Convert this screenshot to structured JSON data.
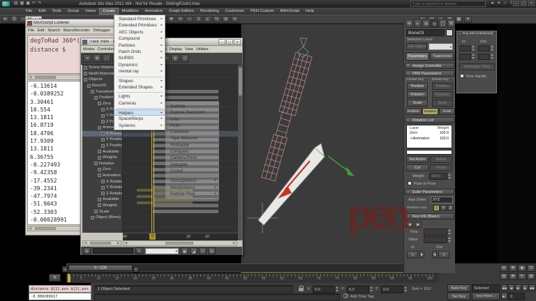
{
  "titlebar": {
    "title": "Autodesk 3ds Max 2012 x64 - Not for Resale - StirlingRJoint.max",
    "search_placeholder": "Type a keyword or phrase",
    "quick_icons": [
      {
        "name": "new-scene-icon",
        "glyph": "▤"
      },
      {
        "name": "open-file-icon",
        "glyph": "▦"
      },
      {
        "name": "save-file-icon",
        "glyph": "▣"
      },
      {
        "name": "undo-icon",
        "glyph": "↶"
      },
      {
        "name": "redo-icon",
        "glyph": "↷"
      }
    ],
    "right_icons": [
      {
        "name": "search-go-icon",
        "glyph": "➤"
      },
      {
        "name": "communication-center-icon",
        "glyph": "✦"
      },
      {
        "name": "favorites-icon",
        "glyph": "☆"
      },
      {
        "name": "help-icon",
        "glyph": "?"
      }
    ],
    "window_buttons": [
      {
        "name": "minimize-button",
        "glyph": "—"
      },
      {
        "name": "maximize-button",
        "glyph": "▢"
      },
      {
        "name": "close-button",
        "glyph": "✕"
      }
    ]
  },
  "menubar": {
    "items": [
      {
        "label": "File"
      },
      {
        "label": "Edit"
      },
      {
        "label": "Tools"
      },
      {
        "label": "Group"
      },
      {
        "label": "Views"
      },
      {
        "label": "Create",
        "cls": "active"
      },
      {
        "label": "Modifiers"
      },
      {
        "label": "Animation"
      },
      {
        "label": "Graph Editors"
      },
      {
        "label": "Rendering"
      },
      {
        "label": "Customize"
      },
      {
        "label": "PEN Custom"
      },
      {
        "label": "MAXScript"
      },
      {
        "label": "Help"
      }
    ]
  },
  "toolbar": {
    "filter_value": "All",
    "left_icons": [
      {
        "name": "select-object-icon",
        "glyph": "➤"
      },
      {
        "name": "select-by-name-icon",
        "glyph": "☰"
      },
      {
        "name": "rectangular-region-icon",
        "glyph": "▭"
      }
    ],
    "mid_icons": [
      {
        "name": "select-move-icon",
        "glyph": "✥"
      },
      {
        "name": "select-rotate-icon",
        "glyph": "↻"
      },
      {
        "name": "select-scale-icon",
        "glyph": "▱"
      },
      {
        "name": "snap-toggle-icon",
        "glyph": "3"
      },
      {
        "name": "angle-snap-icon",
        "glyph": "∠"
      },
      {
        "name": "percent-snap-icon",
        "glyph": "%"
      },
      {
        "name": "mirror-icon",
        "glyph": "⊞"
      },
      {
        "name": "align-icon",
        "glyph": "≋"
      }
    ],
    "right_icons": [
      {
        "name": "curve-editor-icon",
        "glyph": "∿"
      },
      {
        "name": "schematic-view-icon",
        "glyph": "⊡"
      },
      {
        "name": "material-editor-icon",
        "glyph": "◑"
      },
      {
        "name": "render-setup-icon",
        "glyph": "⚙"
      },
      {
        "name": "render-frame-icon",
        "glyph": "▦"
      },
      {
        "name": "render-icon",
        "glyph": "✦"
      }
    ]
  },
  "create_menu": {
    "items": [
      {
        "label": "Standard Primitives"
      },
      {
        "label": "Extended Primitives"
      },
      {
        "label": "AEC Objects"
      },
      {
        "label": "Compound"
      },
      {
        "label": "Particles"
      },
      {
        "label": "Patch Grids"
      },
      {
        "label": "NURBS"
      },
      {
        "label": "Dynamics"
      },
      {
        "label": "mental ray"
      },
      {
        "label": "",
        "cls": "sep"
      },
      {
        "label": "Shapes"
      },
      {
        "label": "Extended Shapes"
      },
      {
        "label": "",
        "cls": "sep"
      },
      {
        "label": "Lights"
      },
      {
        "label": "Cameras"
      },
      {
        "label": "",
        "cls": "sep"
      },
      {
        "label": "Helpers",
        "cls": "hl"
      },
      {
        "label": "SpaceWarps"
      },
      {
        "label": "Systems"
      }
    ]
  },
  "helpers_submenu": {
    "items": [
      {
        "label": "Dummy"
      },
      {
        "label": "Expose Transform"
      },
      {
        "label": "Grid"
      },
      {
        "label": "Point"
      },
      {
        "label": "Container"
      },
      {
        "label": "Tape Measure"
      },
      {
        "label": "Protractor"
      },
      {
        "label": "Compass"
      },
      {
        "label": "Camera Point"
      },
      {
        "label": "Delegate"
      },
      {
        "label": "Crowd"
      },
      {
        "label": "",
        "cls": "sep"
      },
      {
        "label": "Atmospherics",
        "cls": "arrow"
      },
      {
        "label": "Manipulators",
        "cls": "arrow"
      },
      {
        "label": "Particle Flow",
        "cls": "arrow"
      }
    ]
  },
  "listener": {
    "title": "MAXScript Listener",
    "menus": [
      {
        "label": "File"
      },
      {
        "label": "Edit"
      },
      {
        "label": "Search"
      },
      {
        "label": "MacroRecorder"
      },
      {
        "label": "Debugger"
      }
    ],
    "pink_lines": "degToRad 360*(9\ndistance $",
    "values": [
      "-6.13614",
      "-0.0389252",
      "3.30461",
      "10.554",
      "13.1811",
      "16.8719",
      "18.4706",
      "17.9309",
      "13.1811",
      "6.36755",
      "-0.227493",
      "-9.42358",
      "-17.4552",
      "-39.2341",
      "-47.7974",
      "-51.9043",
      "-52.3303",
      "-0.00028991"
    ]
  },
  "track_view": {
    "title": "Track View - Dope Sheet",
    "menus": [
      {
        "label": "Modes"
      },
      {
        "label": "Controller"
      },
      {
        "label": "Tracks"
      },
      {
        "label": "Keys"
      },
      {
        "label": "Time"
      },
      {
        "label": "Options"
      },
      {
        "label": "Display"
      },
      {
        "label": "View"
      },
      {
        "label": "Utilities"
      }
    ],
    "toolbar_icons": [
      {
        "name": "filters-icon",
        "glyph": "≡"
      },
      {
        "name": "move-keys-icon",
        "glyph": "✥"
      },
      {
        "name": "slide-keys-icon",
        "glyph": "↔"
      },
      {
        "name": "scale-keys-icon",
        "glyph": "▱"
      },
      {
        "name": "add-keys-icon",
        "glyph": "◆"
      },
      {
        "name": "draw-curves-icon",
        "glyph": "✎"
      },
      {
        "name": "edit-ranges-icon",
        "glyph": "⊞"
      },
      {
        "name": "snap-frames-icon",
        "glyph": "◇"
      },
      {
        "name": "cut-keys-icon",
        "glyph": "✂"
      },
      {
        "name": "zoom-icon",
        "glyph": "⊕"
      },
      {
        "name": "pan-icon",
        "glyph": "⊙"
      }
    ],
    "tree": [
      {
        "label": "Scene Materials",
        "cls": "l0"
      },
      {
        "label": "Medit Materials",
        "cls": "l0"
      },
      {
        "label": "Objects",
        "cls": "l0"
      },
      {
        "label": "Bone03",
        "cls": "l1"
      },
      {
        "label": "Transform",
        "cls": "l2"
      },
      {
        "label": "Position",
        "cls": "l3"
      },
      {
        "label": "Zero",
        "cls": "l4"
      },
      {
        "label": "X Position",
        "cls": "l5"
      },
      {
        "label": "Y Position",
        "cls": "l5"
      },
      {
        "label": "Z Position",
        "cls": "l5"
      },
      {
        "label": "Animation",
        "cls": "l4"
      },
      {
        "label": "X Position",
        "cls": "l5 sel"
      },
      {
        "label": "Y Position",
        "cls": "l5"
      },
      {
        "label": "Z Position",
        "cls": "l5"
      },
      {
        "label": "Available",
        "cls": "l4"
      },
      {
        "label": "Weights",
        "cls": "l4"
      },
      {
        "label": "Rotation",
        "cls": "l3"
      },
      {
        "label": "Zero",
        "cls": "l4"
      },
      {
        "label": "Animation",
        "cls": "l4"
      },
      {
        "label": "X Rotation",
        "cls": "l5"
      },
      {
        "label": "Y Rotation",
        "cls": "l5"
      },
      {
        "label": "Z Rotation",
        "cls": "l5"
      },
      {
        "label": "Available",
        "cls": "l4"
      },
      {
        "label": "Weights",
        "cls": "l4"
      },
      {
        "label": "Scale",
        "cls": "l3"
      },
      {
        "label": "Object (Bone)",
        "cls": "l2"
      }
    ],
    "ruler_labels": [
      {
        "label": ""
      },
      {
        "label": "30"
      },
      {
        "label": "60"
      },
      {
        "label": "90"
      }
    ],
    "ruler_marker": "0",
    "footer_icons": [
      {
        "name": "track-select-icon",
        "glyph": "▣"
      },
      {
        "name": "key-stats-icon",
        "glyph": "◪"
      },
      {
        "name": "time-tools-icon",
        "glyph": "⊟"
      },
      {
        "name": "maximize-icon",
        "glyph": "⊞"
      }
    ]
  },
  "command_panel": {
    "tabs": [
      {
        "name": "tab-create",
        "glyph": "✛"
      },
      {
        "name": "tab-modify",
        "glyph": "◐"
      },
      {
        "name": "tab-hierarchy",
        "glyph": "≣"
      },
      {
        "name": "tab-motion",
        "glyph": "◎",
        "cls": "on"
      },
      {
        "name": "tab-display",
        "glyph": "▢"
      },
      {
        "name": "tab-utilities",
        "glyph": "⚒"
      }
    ],
    "object_name": "Bone03",
    "selection_level_label": "Selection Level:",
    "subobject_button": "Sub-Object",
    "parameters_button": "Parameters",
    "trajectories_button": "Trajectories",
    "assign_controller_title": "Assign Controller",
    "prs": {
      "title": "PRS Parameters",
      "create_key_label": "Create Key:",
      "delete_key_label": "Delete Key:",
      "create_keys": [
        {
          "label": "Position"
        },
        {
          "label": "Rotation"
        },
        {
          "label": "Scale"
        }
      ],
      "delete_keys": [
        {
          "label": "Position"
        },
        {
          "label": "Rotation"
        },
        {
          "label": "Scale"
        }
      ],
      "mode_buttons": [
        {
          "label": "Position"
        },
        {
          "label": "Rotation",
          "cls": "tan"
        },
        {
          "label": "Scale"
        }
      ]
    },
    "rotation_list": {
      "title": "Rotation List",
      "col_layer": "Layer",
      "col_weight": "Weight",
      "rows": [
        {
          "layer": "Zero",
          "weight": "100.0"
        },
        {
          "layer": "->Animation",
          "weight": "100.0"
        }
      ],
      "set_active_button": "Set Active",
      "delete_button": "Delete",
      "cut_button": "Cut",
      "paste_button": "Paste",
      "weight_label": "Weight:",
      "weight_value": "100.0",
      "pose_to_pose_label": "Pose to Pose"
    },
    "euler": {
      "title": "Euler Parameters",
      "axis_order_label": "Axis Order:",
      "axis_order_value": "XYZ",
      "rotation_axis_label": "Rotation Axis:",
      "axes": [
        {
          "label": "X",
          "cls": "tan"
        },
        {
          "label": "Y"
        },
        {
          "label": "Z"
        }
      ]
    },
    "key_info_basic": {
      "title": "Key Info (Basic)",
      "time_label": "Time:",
      "value_label": "Value:",
      "in_label": "In:",
      "out_label": "Out:"
    }
  },
  "key_info_advanced": {
    "title": "Key Info (Advanced)",
    "in_label": "In:",
    "out_label": "Out:",
    "normalize_button": "Normalize Time",
    "free_handle_label": "Free Handle"
  },
  "timeline": {
    "range": "0 / 100",
    "tick_labels": [
      {
        "label": "5"
      },
      {
        "label": "10"
      },
      {
        "label": "15"
      },
      {
        "label": "20"
      },
      {
        "label": "25"
      },
      {
        "label": "30"
      },
      {
        "label": "35"
      },
      {
        "label": "40"
      },
      {
        "label": "45"
      },
      {
        "label": "50"
      },
      {
        "label": "55"
      },
      {
        "label": "60"
      },
      {
        "label": "65"
      },
      {
        "label": "70"
      },
      {
        "label": "75"
      },
      {
        "label": "80"
      },
      {
        "label": "85"
      },
      {
        "label": "90"
      },
      {
        "label": "95"
      },
      {
        "label": "100"
      }
    ]
  },
  "status": {
    "mini_listener": "distance $[1].pos $[2].pos",
    "mini_result": "-0.000289917",
    "selection_status": "1 Object Selected",
    "prompt": "",
    "x_label": "X:",
    "y_label": "Y:",
    "z_label": "Z:",
    "x_value": "0.0",
    "y_value": "0.0",
    "z_value": "0.0",
    "grid": "Grid = 10.0",
    "add_time_tag": "Add Time Tag",
    "auto_key": "Auto Key",
    "set_key": "Set Key",
    "selected_filter": "Selected",
    "key_filters": "Key Filters...",
    "frame_value": "0",
    "playback_icons": [
      {
        "name": "go-to-start-icon",
        "glyph": "◀◀"
      },
      {
        "name": "prev-frame-icon",
        "glyph": "◀"
      },
      {
        "name": "play-icon",
        "glyph": "▶"
      },
      {
        "name": "next-frame-icon",
        "glyph": "▶"
      },
      {
        "name": "go-to-end-icon",
        "glyph": "▶▶"
      }
    ],
    "nav_icons_row1": [
      {
        "name": "zoom-icon",
        "glyph": "⊕"
      },
      {
        "name": "zoom-all-icon",
        "glyph": "✥"
      },
      {
        "name": "zoom-extents-icon",
        "glyph": "◉"
      },
      {
        "name": "zoom-region-icon",
        "glyph": "⊡"
      }
    ],
    "nav_icons_row2": [
      {
        "name": "field-of-view-icon",
        "glyph": "⊞"
      },
      {
        "name": "pan-icon",
        "glyph": "✥"
      },
      {
        "name": "orbit-icon",
        "glyph": "↻"
      },
      {
        "name": "maximize-viewport-icon",
        "glyph": "⊠"
      }
    ]
  },
  "watermark": {
    "logo": "pen",
    "text": "penproductions"
  },
  "colors": {
    "wireframe": "#d49494",
    "bone_fill": "#e8e8e4",
    "bone_stroke": "#8f8f8f",
    "arrow_red": "#c23524",
    "arrow_green": "#3f9e3c",
    "gizmo_gray": "#8f8f8f",
    "diamond_teal": "#7ba3a3",
    "active_tan": "#b3a466",
    "watermark_red": "#7a1e16"
  }
}
